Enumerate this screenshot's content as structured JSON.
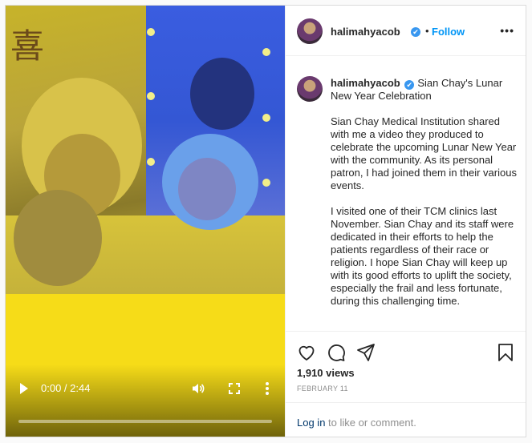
{
  "video": {
    "time": "0:00 / 2:44",
    "progress": 0.0,
    "icons": [
      "play-icon",
      "volume-icon",
      "fullscreen-icon",
      "more-vertical-icon"
    ]
  },
  "header": {
    "username": "halimahyacob",
    "verified": "✔",
    "separator": "•",
    "follow_label": "Follow",
    "more": "•••"
  },
  "caption": {
    "username": "halimahyacob",
    "verified": "✔",
    "headline": "Sian Chay's Lunar New Year Celebration",
    "paragraphs": [
      "Sian Chay Medical Institution shared with me a video they produced to celebrate the upcoming Lunar New Year with the community. As its personal patron, I had joined them in their various events.",
      "I visited one of their TCM clinics last November. Sian Chay and its staff were dedicated in their efforts to help the patients regardless of their race or religion. I hope Sian Chay will keep up with its good efforts to uplift the society, especially the frail and less fortunate, during this challenging time."
    ]
  },
  "actions": [
    "heart-icon",
    "comment-icon",
    "share-icon",
    "bookmark-icon"
  ],
  "views": "1,910 views",
  "date": "FEBRUARY 11",
  "comment": {
    "login_link": "Log in",
    "login_rest": " to like or comment."
  },
  "colors": {
    "accent": "#0095f6",
    "verified": "#3897f0",
    "media_yellow": "#f6dc18",
    "media_blue": "#3457d4"
  }
}
